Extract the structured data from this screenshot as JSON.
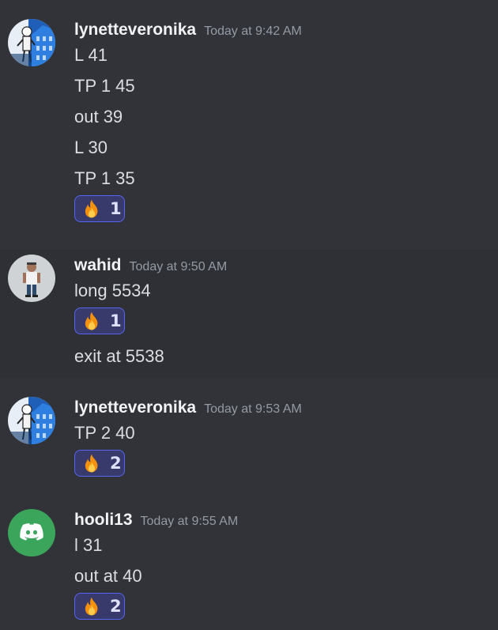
{
  "messages": [
    {
      "username": "lynetteveronika",
      "timestamp": "Today at 9:42 AM",
      "avatar": "character-on-blue-building-avatar",
      "lines": [
        "L 41",
        "TP 1  45",
        "out 39",
        "L 30",
        "TP 1 35"
      ],
      "reaction": {
        "emoji": "fire",
        "count": "1"
      }
    },
    {
      "username": "wahid",
      "timestamp": "Today at 9:50 AM",
      "avatar": "standing-figure-avatar",
      "lines": [
        "long 5534",
        "exit at 5538"
      ],
      "reaction": {
        "emoji": "fire",
        "count": "1"
      }
    },
    {
      "username": "lynetteveronika",
      "timestamp": "Today at 9:53 AM",
      "avatar": "character-on-blue-building-avatar",
      "lines": [
        "TP 2   40"
      ],
      "reaction": {
        "emoji": "fire",
        "count": "2"
      }
    },
    {
      "username": "hooli13",
      "timestamp": "Today at 9:55 AM",
      "avatar": "discord-default-avatar",
      "lines": [
        "l 31",
        "out at 40"
      ],
      "reaction": {
        "emoji": "fire",
        "count": "2"
      }
    }
  ],
  "colors": {
    "background": "#313338",
    "hover_background": "#2e3035",
    "username": "#f2f3f5",
    "timestamp": "#949ba4",
    "message_text": "#dbdee1",
    "reaction_border": "#5865f2",
    "reaction_bg": "#373a6b",
    "discord_green": "#3ba55c"
  }
}
